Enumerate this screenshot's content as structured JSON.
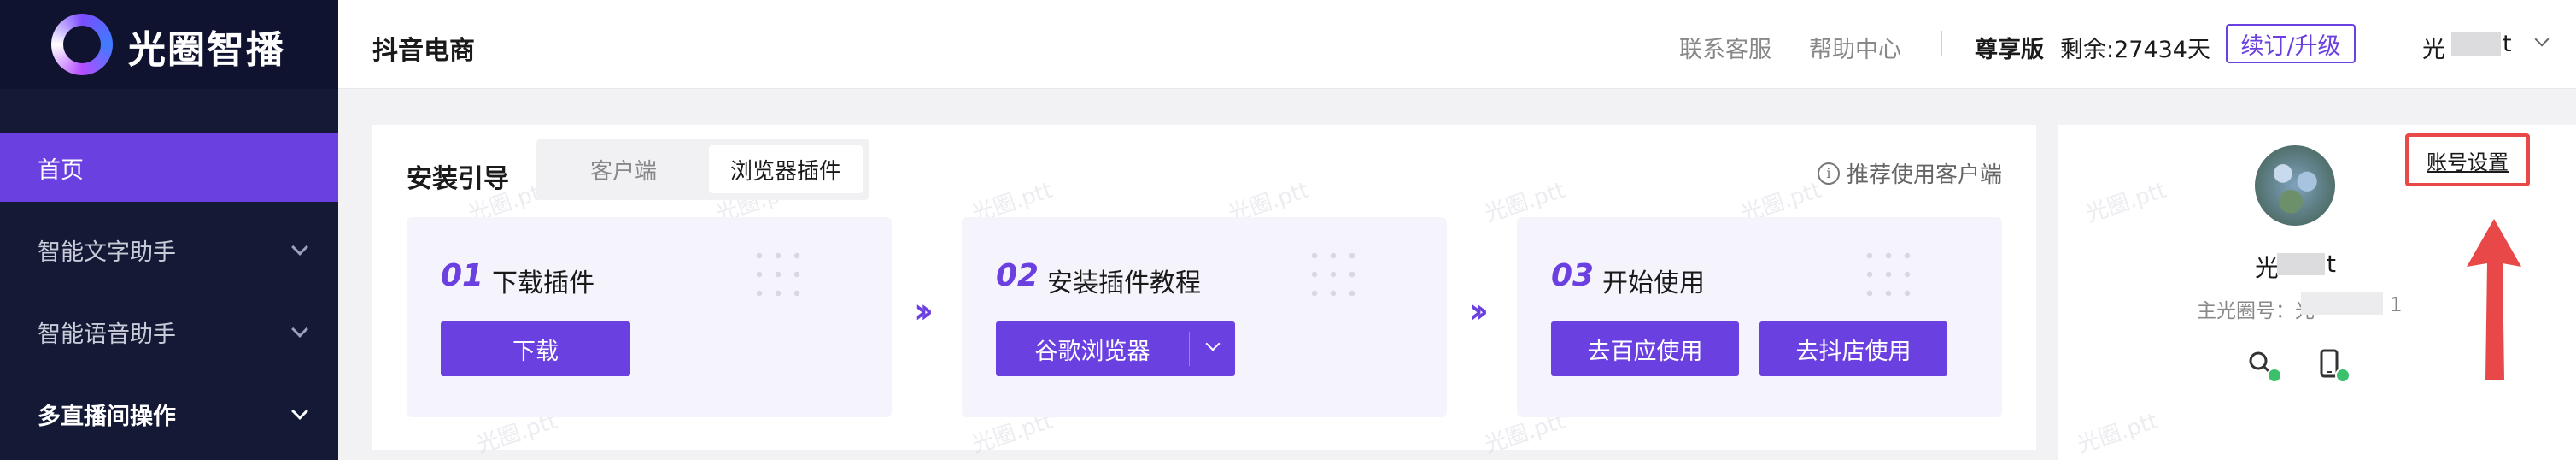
{
  "brand": {
    "name": "光圈智播"
  },
  "sidebar": {
    "items": [
      {
        "label": "首页"
      },
      {
        "label": "智能文字助手"
      },
      {
        "label": "智能语音助手"
      },
      {
        "label": "多直播间操作"
      }
    ]
  },
  "header": {
    "title": "抖音电商",
    "links": [
      "联系客服",
      "帮助中心"
    ],
    "plan": "尊享版",
    "remaining": "剩余:27434天",
    "renew_label": "续订/升级",
    "user_prefix": "光",
    "user_suffix": "t"
  },
  "install": {
    "title": "安装引导",
    "tabs": [
      {
        "label": "客户端",
        "active": false
      },
      {
        "label": "浏览器插件",
        "active": true
      }
    ],
    "recommend": "推荐使用客户端",
    "steps": [
      {
        "num": "01",
        "title": "下载插件",
        "buttons": [
          "下载"
        ]
      },
      {
        "num": "02",
        "title": "安装插件教程",
        "buttons": [
          "谷歌浏览器"
        ]
      },
      {
        "num": "03",
        "title": "开始使用",
        "buttons": [
          "去百应使用",
          "去抖店使用"
        ]
      }
    ],
    "watermark": "光圈.ptt"
  },
  "account": {
    "settings_label": "账号设置",
    "name_prefix": "光",
    "name_suffix": "t",
    "id_label": "主光圈号：光",
    "id_suffix": "1"
  },
  "colors": {
    "accent": "#6a40e0",
    "sidebar_bg": "#141a36",
    "highlight_red": "#e84848",
    "verified_green": "#3cc06b"
  },
  "icons": [
    "logo-ring-icon",
    "chevron-down-icon",
    "info-icon",
    "double-chevron-right-icon",
    "search-verified-icon",
    "phone-verified-icon",
    "red-up-arrow-icon"
  ]
}
